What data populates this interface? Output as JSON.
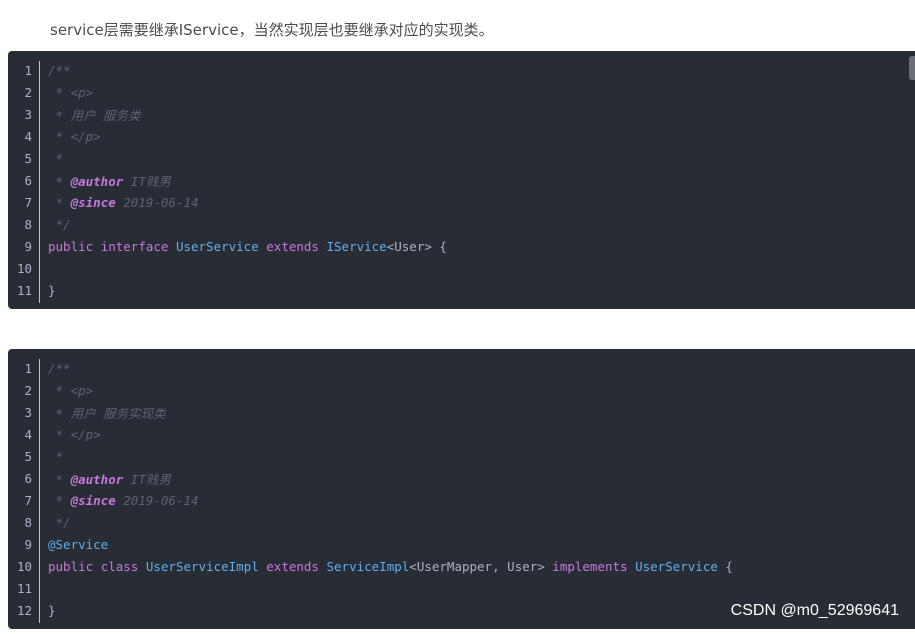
{
  "intro_text": "service层需要继承IService，当然实现层也要继承对应的实现类。",
  "watermark": "CSDN @m0_52969641",
  "code_blocks": [
    {
      "lines": [
        [
          {
            "t": "/**",
            "c": "comment"
          }
        ],
        [
          {
            "t": " * <p>",
            "c": "comment"
          }
        ],
        [
          {
            "t": " * 用户 服务类",
            "c": "comment"
          }
        ],
        [
          {
            "t": " * </p>",
            "c": "comment"
          }
        ],
        [
          {
            "t": " *",
            "c": "comment"
          }
        ],
        [
          {
            "t": " * ",
            "c": "comment"
          },
          {
            "t": "@author",
            "c": "tag"
          },
          {
            "t": " IT贱男",
            "c": "comment"
          }
        ],
        [
          {
            "t": " * ",
            "c": "comment"
          },
          {
            "t": "@since",
            "c": "tag"
          },
          {
            "t": " 2019-06-14",
            "c": "comment"
          }
        ],
        [
          {
            "t": " */",
            "c": "comment"
          }
        ],
        [
          {
            "t": "public",
            "c": "keyword"
          },
          {
            "t": " ",
            "c": "plain"
          },
          {
            "t": "interface",
            "c": "keyword"
          },
          {
            "t": " ",
            "c": "plain"
          },
          {
            "t": "UserService",
            "c": "type"
          },
          {
            "t": " ",
            "c": "plain"
          },
          {
            "t": "extends",
            "c": "keyword"
          },
          {
            "t": " ",
            "c": "plain"
          },
          {
            "t": "IService",
            "c": "type"
          },
          {
            "t": "<User> {",
            "c": "plain"
          }
        ],
        [],
        [
          {
            "t": "}",
            "c": "plain"
          }
        ]
      ]
    },
    {
      "lines": [
        [
          {
            "t": "/**",
            "c": "comment"
          }
        ],
        [
          {
            "t": " * <p>",
            "c": "comment"
          }
        ],
        [
          {
            "t": " * 用户 服务实现类",
            "c": "comment"
          }
        ],
        [
          {
            "t": " * </p>",
            "c": "comment"
          }
        ],
        [
          {
            "t": " *",
            "c": "comment"
          }
        ],
        [
          {
            "t": " * ",
            "c": "comment"
          },
          {
            "t": "@author",
            "c": "tag"
          },
          {
            "t": " IT贱男",
            "c": "comment"
          }
        ],
        [
          {
            "t": " * ",
            "c": "comment"
          },
          {
            "t": "@since",
            "c": "tag"
          },
          {
            "t": " 2019-06-14",
            "c": "comment"
          }
        ],
        [
          {
            "t": " */",
            "c": "comment"
          }
        ],
        [
          {
            "t": "@Service",
            "c": "type"
          }
        ],
        [
          {
            "t": "public",
            "c": "keyword"
          },
          {
            "t": " ",
            "c": "plain"
          },
          {
            "t": "class",
            "c": "keyword"
          },
          {
            "t": " ",
            "c": "plain"
          },
          {
            "t": "UserServiceImpl",
            "c": "type"
          },
          {
            "t": " ",
            "c": "plain"
          },
          {
            "t": "extends",
            "c": "keyword"
          },
          {
            "t": " ",
            "c": "plain"
          },
          {
            "t": "ServiceImpl",
            "c": "type"
          },
          {
            "t": "<UserMapper, User> ",
            "c": "plain"
          },
          {
            "t": "implements",
            "c": "keyword"
          },
          {
            "t": " ",
            "c": "plain"
          },
          {
            "t": "UserService",
            "c": "type"
          },
          {
            "t": " {",
            "c": "plain"
          }
        ],
        [],
        [
          {
            "t": "}",
            "c": "plain"
          }
        ]
      ]
    }
  ]
}
